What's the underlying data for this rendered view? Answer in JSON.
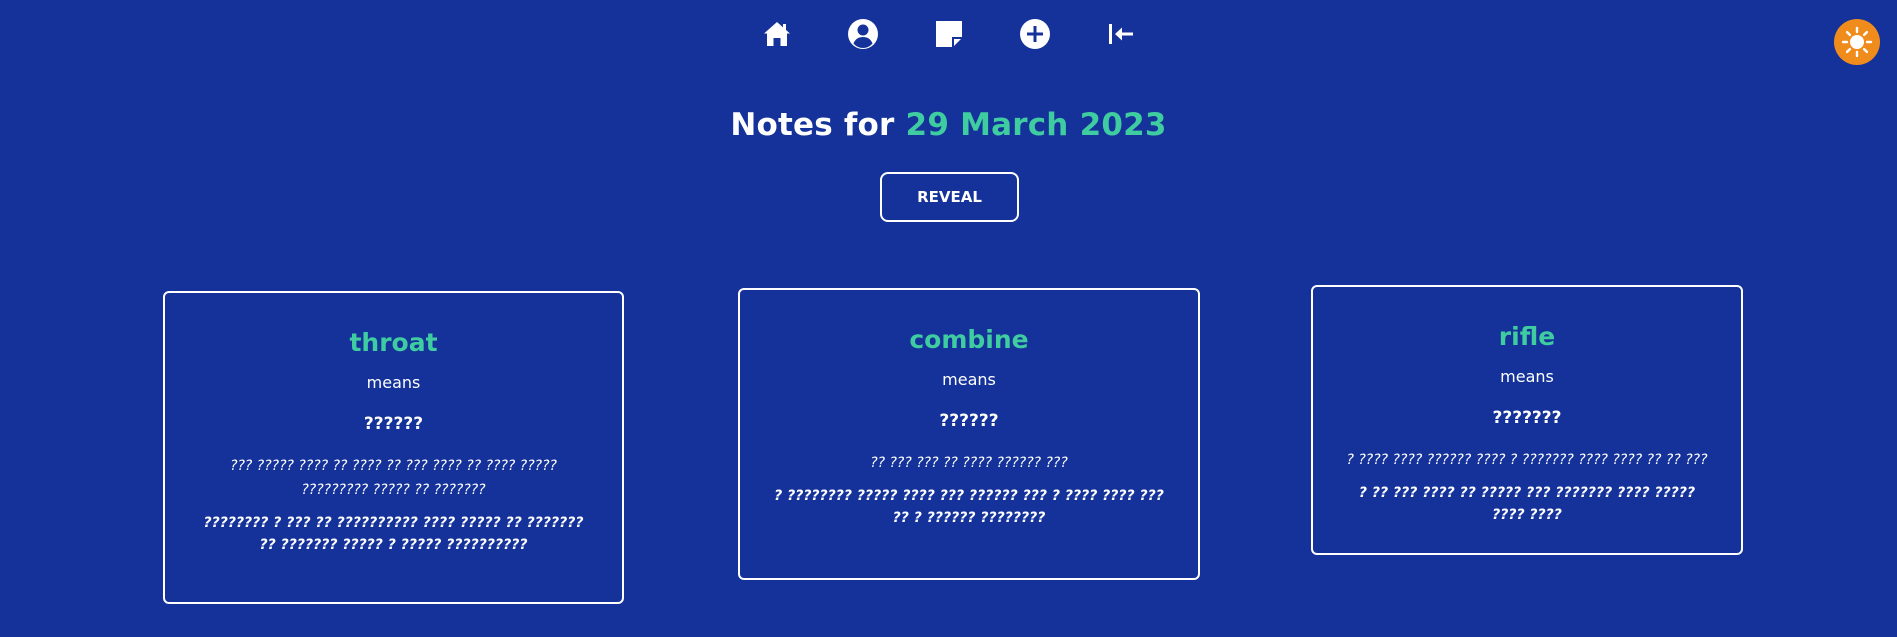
{
  "nav": {
    "items": [
      {
        "name": "home",
        "icon": "home-icon"
      },
      {
        "name": "profile",
        "icon": "user-circle-icon"
      },
      {
        "name": "notes",
        "icon": "sticky-note-icon"
      },
      {
        "name": "add",
        "icon": "plus-circle-icon"
      },
      {
        "name": "collapse",
        "icon": "arrow-left-to-bar-icon"
      }
    ],
    "theme_toggle_icon": "sun-icon",
    "theme_toggle_color": "#f08c1b"
  },
  "header": {
    "prefix": "Notes for ",
    "date": "29 March 2023",
    "date_color": "#3fcca0"
  },
  "reveal_label": "REVEAL",
  "cards": [
    {
      "word": "throat",
      "means": "means",
      "translation": "??????",
      "example_1": "??? ????? ???? ?? ???? ?? ??? ???? ?? ???? ????? ????????? ????? ?? ???????",
      "example_2": "???????? ? ??? ?? ?????????? ???? ????? ?? ??????? ?? ??????? ????? ? ????? ??????????"
    },
    {
      "word": "combine",
      "means": "means",
      "translation": "??????",
      "example_1": "?? ??? ??? ?? ???? ?????? ???",
      "example_2": "? ???????? ????? ???? ??? ?????? ??? ? ???? ???? ??? ?? ? ?????? ????????"
    },
    {
      "word": "rifle",
      "means": "means",
      "translation": "???????",
      "example_1": "? ???? ???? ?????? ???? ? ??????? ???? ???? ?? ?? ???",
      "example_2": "? ?? ??? ???? ?? ????? ??? ??????? ???? ????? ???? ????"
    }
  ],
  "colors": {
    "background": "#143299",
    "accent": "#3fcca0",
    "text": "#ffffff"
  }
}
